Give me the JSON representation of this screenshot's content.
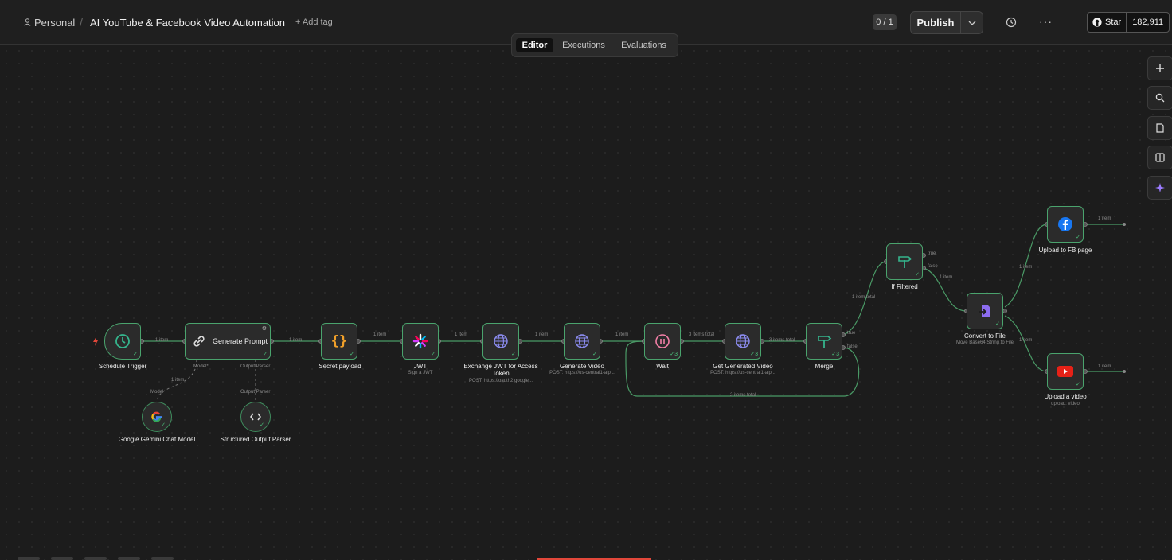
{
  "header": {
    "project": "Personal",
    "workflow_title": "AI YouTube & Facebook Video Automation",
    "add_tag": "+ Add tag",
    "counter": "0 / 1",
    "publish_label": "Publish",
    "github_star": "Star",
    "github_count": "182,911"
  },
  "tabs": [
    "Editor",
    "Executions",
    "Evaluations"
  ],
  "nodes": {
    "schedule": {
      "label": "Schedule Trigger"
    },
    "generate_prompt": {
      "label": "Generate Prompt",
      "port_model": "Model*",
      "port_parser": "Output Parser"
    },
    "gemini": {
      "label": "Google Gemini Chat Model",
      "port": "Model"
    },
    "parser": {
      "label": "Structured Output Parser",
      "port": "Output Parser"
    },
    "secret": {
      "label": "Secret payload"
    },
    "jwt": {
      "label": "JWT",
      "sub": "Sign a JWT"
    },
    "exchange": {
      "label": "Exchange JWT for Access Token",
      "sub": "POST: https://oauth2.google..."
    },
    "generate_video": {
      "label": "Generate Video",
      "sub": "POST: https://us-central1-aip..."
    },
    "wait": {
      "label": "Wait"
    },
    "get_video": {
      "label": "Get Generated Video",
      "sub": "POST: https://us-central1-aip..."
    },
    "merge": {
      "label": "Merge",
      "port_true": "true",
      "port_false": "false"
    },
    "if_filtered": {
      "label": "If Filtered",
      "port_true": "true",
      "port_false": "false"
    },
    "convert": {
      "label": "Convert to File",
      "sub": "Move Base64 String to File"
    },
    "fb": {
      "label": "Upload to FB page"
    },
    "yt": {
      "label": "Upload a video",
      "sub": "upload: video"
    }
  },
  "edges": {
    "e1": "1 item",
    "e2": "1 item",
    "e3": "1 item",
    "e4": "1 item",
    "e5": "1 item",
    "e6": "1 item",
    "e7": "3 items total",
    "e8": "3 items total",
    "e9": "1 item total",
    "e10": "1 item",
    "e11": "1 item",
    "e12": "1 item",
    "e13": "1 item",
    "e14": "1 item",
    "e15": "1 item",
    "loop": "2 items total",
    "model_edge": "1 item"
  },
  "colors": {
    "accent_green": "#4aa36d",
    "canvas_bg": "#1c1c1c",
    "facebook_blue": "#1877f2",
    "youtube_red": "#e62117"
  }
}
